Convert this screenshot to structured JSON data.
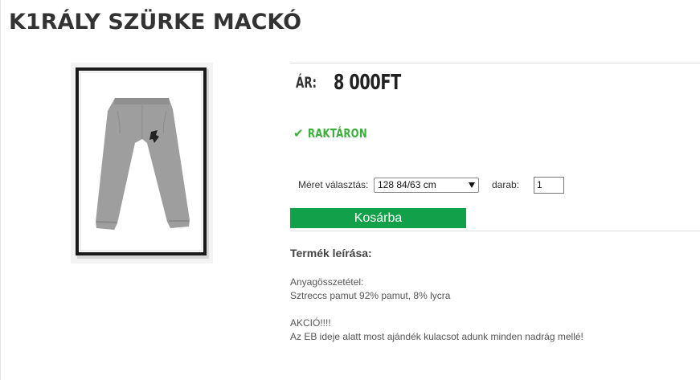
{
  "product": {
    "title": "K1RÁLY SZÜRKE MACKÓ",
    "image_description_icon": "sweatpants-product-image"
  },
  "price": {
    "label": "ÁR:",
    "value": "8 000FT"
  },
  "stock": {
    "icon": "check-icon",
    "label": "RAKTÁRON",
    "color": "#3cae3c"
  },
  "options": {
    "size_label": "Méret választás:",
    "size_selected": "128 84/63 cm",
    "quantity_label": "darab:",
    "quantity_value": "1"
  },
  "cart": {
    "button_label": "Kosárba",
    "color": "#12a14a"
  },
  "description": {
    "title": "Termék leírása:",
    "lines": [
      "Anyagösszetétel:",
      "Sztreccs pamut 92% pamut, 8% lycra",
      "",
      "AKCIÓ!!!!",
      "Az EB ideje alatt most ajándék kulacsot adunk minden nadrág mellé!"
    ]
  }
}
